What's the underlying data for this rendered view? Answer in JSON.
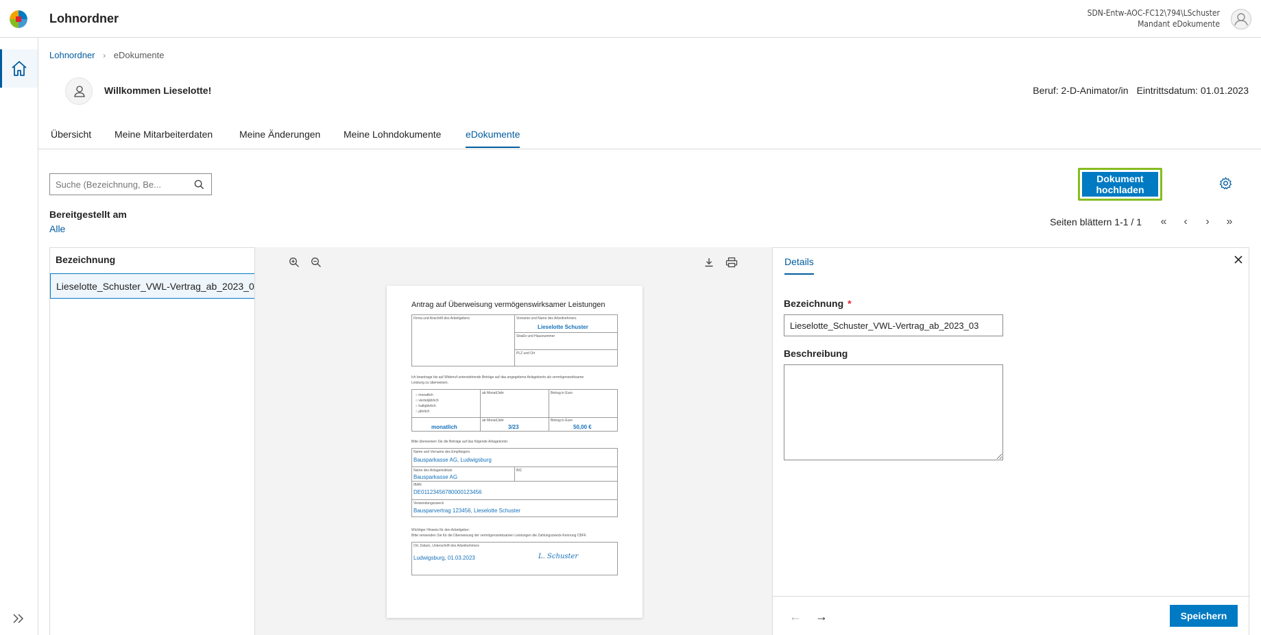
{
  "header": {
    "app_title": "Lohnordner",
    "user_line1": "SDN-Entw-AOC-FC12\\794\\LSchuster",
    "user_line2": "Mandant eDokumente"
  },
  "breadcrumb": {
    "items": [
      "Lohnordner",
      "eDokumente"
    ]
  },
  "welcome": {
    "text": "Willkommen Lieselotte!",
    "beruf": "Beruf: 2-D-Animator/in",
    "eintrittsdatum": "Eintrittsdatum: 01.01.2023"
  },
  "tabs": [
    {
      "label": "Übersicht"
    },
    {
      "label": "Meine Mitarbeiterdaten"
    },
    {
      "label": "Meine Änderungen"
    },
    {
      "label": "Meine Lohndokumente"
    },
    {
      "label": "eDokumente",
      "active": true
    }
  ],
  "toolbar": {
    "search_placeholder": "Suche (Bezeichnung, Be...",
    "upload_label": "Dokument hochladen",
    "filter_label": "Bereitgestellt am",
    "filter_value": "Alle",
    "pager_text": "Seiten blättern 1-1 / 1"
  },
  "list": {
    "header": "Bezeichnung",
    "rows": [
      "Lieselotte_Schuster_VWL-Vertrag_ab_2023_03"
    ]
  },
  "document": {
    "title": "Antrag auf Überweisung vermögenswirksamer Leistungen",
    "label_firma": "Firma und Anschrift des Arbeitgebers",
    "label_name": "Vorname und Name des Arbeitnehmers",
    "value_name": "Lieselotte Schuster",
    "label_strasse": "Straße und Hausnummer",
    "label_plz": "PLZ und Ort",
    "intro_text": "Ich beantrage bis auf Widerruf untenstehende Beträge auf das angegebene Anlagekonto als vermögenswirksame",
    "intro_text2": "Leistung zu überweisen.",
    "options": [
      "monatlich",
      "vierteljährlich",
      "halbjährlich",
      "jährlich"
    ],
    "label_ab": "ab Monat/Jahr",
    "label_betrag": "Betrag in Euro",
    "value_interval": "monatlich",
    "value_ab": "3/23",
    "value_betrag": "50,00 €",
    "transfer_text": "Bitte überweisen Sie die Beträge auf das folgende Anlagekonto:",
    "label_empfaenger": "Name und Vorname des Empfängers",
    "value_empfaenger": "Bausparkasse AG, Ludwigsburg",
    "label_institut": "Name des Anlageinstituts",
    "value_institut": "Bausparkasse AG",
    "label_bic": "BIC",
    "label_iban": "IBAN",
    "value_iban": "DE01123456780000123456",
    "label_zweck": "Verwendungszweck",
    "value_zweck": "Bausparvertrag 123456, Lieselotte Schuster",
    "hint_title": "Wichtiger Hinweis für den Arbeitgeber:",
    "hint_text": "Bitte verwenden Sie für die Überweisung der vermögenswirksamen Leistungen die Zahlungszweck-Kennung CBFF.",
    "label_ort": "Ort, Datum, Unterschrift des Arbeitnehmers",
    "value_ort": "Ludwigsburg, 01.03.2023",
    "signature": "L. Schuster"
  },
  "details": {
    "tab_label": "Details",
    "name_label": "Bezeichnung",
    "required_mark": "*",
    "name_value": "Lieselotte_Schuster_VWL-Vertrag_ab_2023_03",
    "description_label": "Beschreibung",
    "description_value": "",
    "save_label": "Speichern"
  },
  "colors": {
    "primary": "#007ac3",
    "link": "#005b9f",
    "highlight": "#85bc20",
    "required": "#e5202e"
  }
}
